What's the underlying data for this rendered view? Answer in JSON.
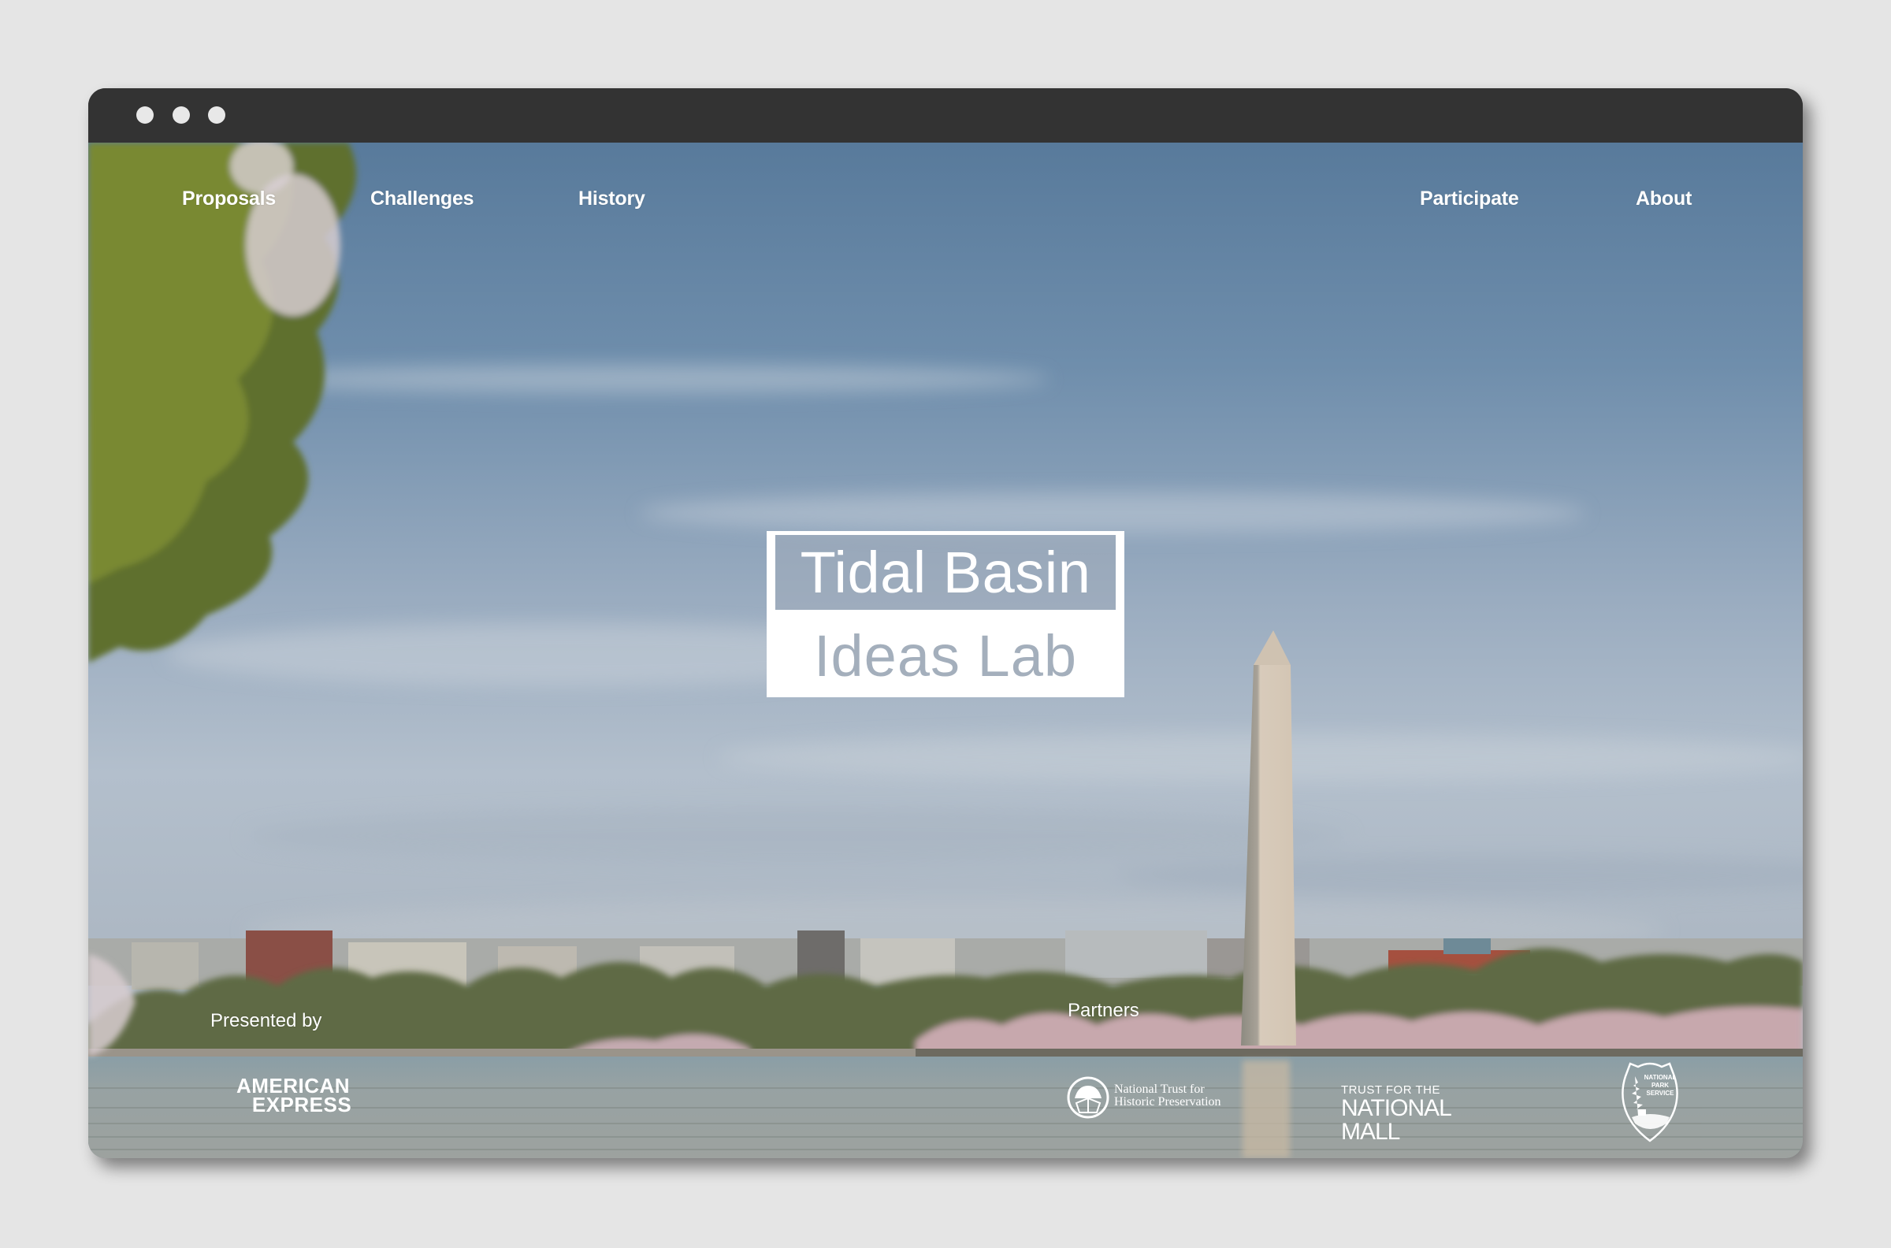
{
  "window": {
    "controls": [
      "close",
      "minimize",
      "maximize"
    ]
  },
  "nav": {
    "left": [
      {
        "label": "Proposals"
      },
      {
        "label": "Challenges"
      },
      {
        "label": "History"
      }
    ],
    "right": [
      {
        "label": "Participate"
      },
      {
        "label": "About"
      }
    ]
  },
  "hero": {
    "title_line1": "Tidal Basin",
    "title_line2": "Ideas Lab",
    "background": "Washington Monument across the Tidal Basin with cherry blossoms"
  },
  "footer": {
    "presented_by_label": "Presented by",
    "presenter": {
      "line1": "AMERICAN",
      "line2": "EXPRESS"
    },
    "partners_label": "Partners",
    "partners": [
      {
        "line1": "National Trust for",
        "line2": "Historic Preservation",
        "icon": "ntpr-seal-icon"
      },
      {
        "line1": "TRUST FOR THE",
        "line2": "NATIONAL MALL"
      },
      {
        "line1": "NATIONAL",
        "line2": "PARK",
        "line3": "SERVICE",
        "icon": "nps-arrowhead-icon"
      }
    ]
  },
  "colors": {
    "page_bg": "#e5e5e5",
    "titlebar": "#333333",
    "logo_text_muted": "#a4afbc",
    "white": "#ffffff"
  }
}
